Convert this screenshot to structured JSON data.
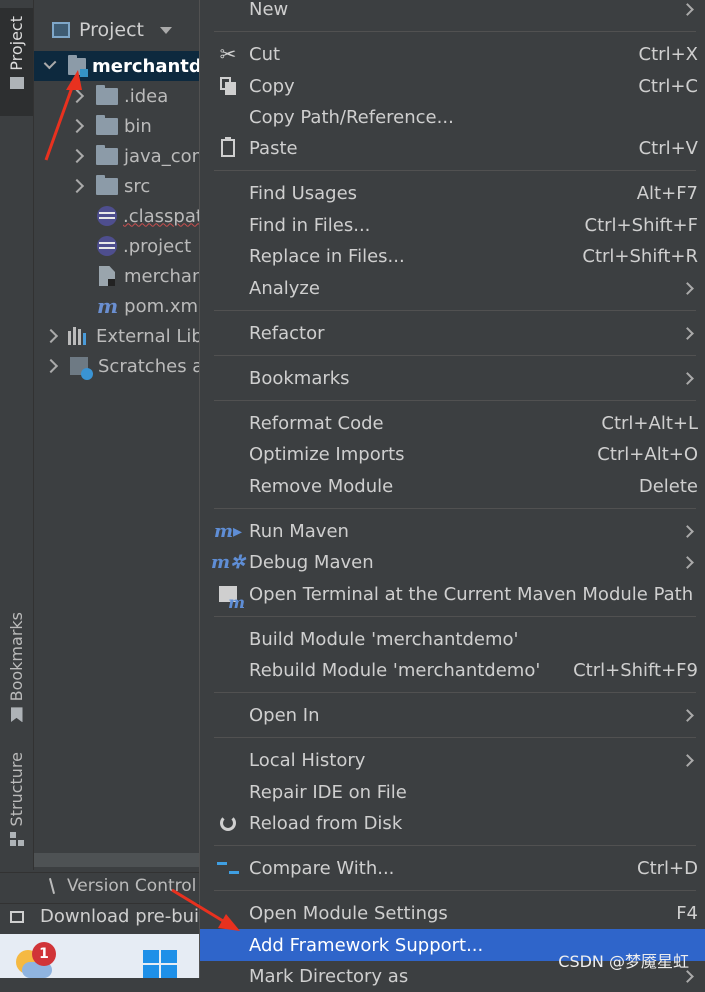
{
  "left_strip": {
    "tabs": [
      {
        "label": "Project",
        "icon": "folder-icon"
      },
      {
        "label": "Bookmarks",
        "icon": "bookmark-icon"
      },
      {
        "label": "Structure",
        "icon": "structure-icon"
      }
    ]
  },
  "project_panel": {
    "title": "Project",
    "tree": [
      {
        "label": "merchantde",
        "icon": "module-folder-icon"
      },
      {
        "label": ".idea",
        "icon": "folder-icon"
      },
      {
        "label": "bin",
        "icon": "folder-icon"
      },
      {
        "label": "java_com",
        "icon": "folder-icon"
      },
      {
        "label": "src",
        "icon": "folder-icon"
      },
      {
        "label": ".classpat",
        "icon": "eclipse-icon"
      },
      {
        "label": ".project",
        "icon": "eclipse-icon"
      },
      {
        "label": "merchan",
        "icon": "iml-file-icon"
      },
      {
        "label": "pom.xml",
        "icon": "maven-icon"
      },
      {
        "label": "External Lib",
        "icon": "library-icon"
      },
      {
        "label": "Scratches ar",
        "icon": "scratches-icon"
      }
    ]
  },
  "bottom": {
    "version_control": "Version Control",
    "status_message": "Download pre-bui",
    "notification_count": "1"
  },
  "context_menu": {
    "items": [
      {
        "label": "New",
        "shortcut": "",
        "submenu": true
      },
      {
        "label": "Cut",
        "shortcut": "Ctrl+X",
        "icon": "scissors-icon"
      },
      {
        "label": "Copy",
        "shortcut": "Ctrl+C",
        "icon": "copy-icon"
      },
      {
        "label": "Copy Path/Reference...",
        "shortcut": ""
      },
      {
        "label": "Paste",
        "shortcut": "Ctrl+V",
        "icon": "paste-icon"
      },
      {
        "label": "Find Usages",
        "shortcut": "Alt+F7"
      },
      {
        "label": "Find in Files...",
        "shortcut": "Ctrl+Shift+F"
      },
      {
        "label": "Replace in Files...",
        "shortcut": "Ctrl+Shift+R"
      },
      {
        "label": "Analyze",
        "shortcut": "",
        "submenu": true
      },
      {
        "label": "Refactor",
        "shortcut": "",
        "submenu": true
      },
      {
        "label": "Bookmarks",
        "shortcut": "",
        "submenu": true
      },
      {
        "label": "Reformat Code",
        "shortcut": "Ctrl+Alt+L"
      },
      {
        "label": "Optimize Imports",
        "shortcut": "Ctrl+Alt+O"
      },
      {
        "label": "Remove Module",
        "shortcut": "Delete"
      },
      {
        "label": "Run Maven",
        "shortcut": "",
        "submenu": true,
        "icon": "maven-run-icon"
      },
      {
        "label": "Debug Maven",
        "shortcut": "",
        "submenu": true,
        "icon": "maven-debug-icon"
      },
      {
        "label": "Open Terminal at the Current Maven Module Path",
        "shortcut": "",
        "icon": "terminal-icon"
      },
      {
        "label": "Build Module 'merchantdemo'",
        "shortcut": ""
      },
      {
        "label": "Rebuild Module 'merchantdemo'",
        "shortcut": "Ctrl+Shift+F9"
      },
      {
        "label": "Open In",
        "shortcut": "",
        "submenu": true
      },
      {
        "label": "Local History",
        "shortcut": "",
        "submenu": true
      },
      {
        "label": "Repair IDE on File",
        "shortcut": ""
      },
      {
        "label": "Reload from Disk",
        "shortcut": "",
        "icon": "reload-icon"
      },
      {
        "label": "Compare With...",
        "shortcut": "Ctrl+D",
        "icon": "compare-icon"
      },
      {
        "label": "Open Module Settings",
        "shortcut": "F4"
      },
      {
        "label": "Add Framework Support...",
        "shortcut": "",
        "highlighted": true
      },
      {
        "label": "Mark Directory as",
        "shortcut": "",
        "submenu": true
      }
    ]
  },
  "watermark": "CSDN @梦魇星虹",
  "colors": {
    "background": "#3c3f41",
    "selection": "#2f65ca",
    "annotation_arrow": "#e8311f"
  }
}
